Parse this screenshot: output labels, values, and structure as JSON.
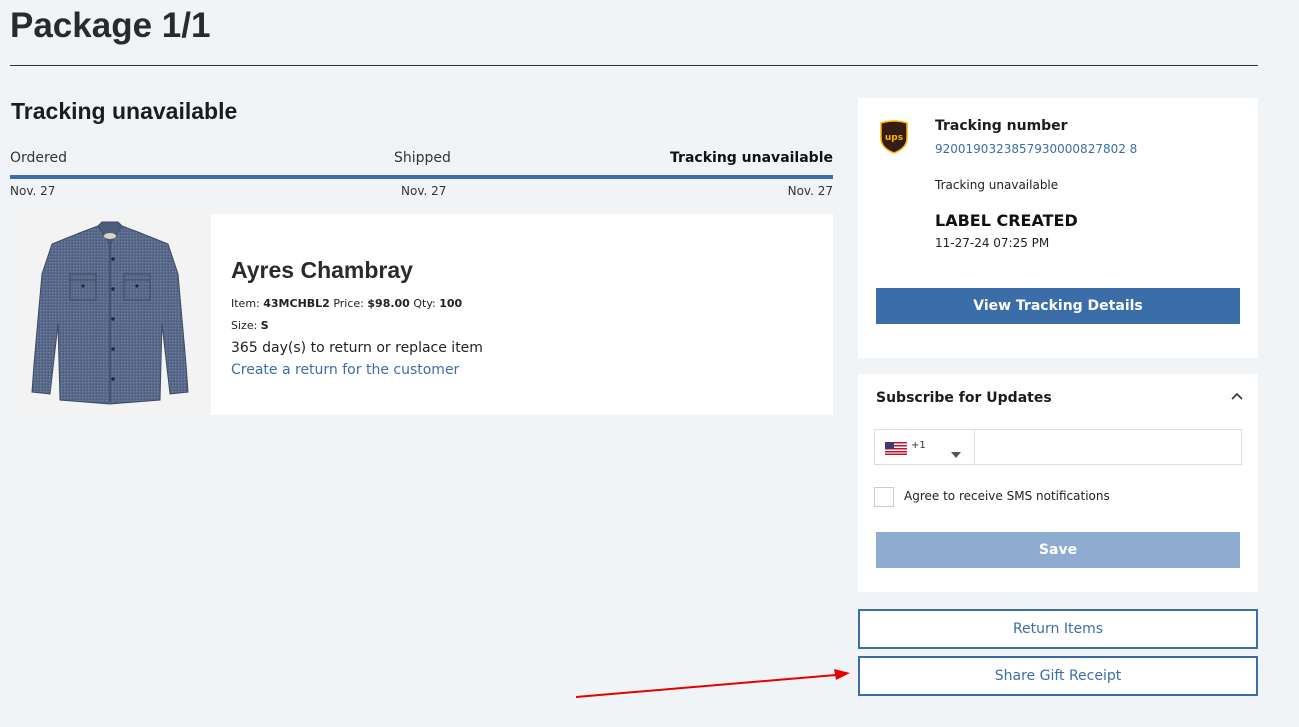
{
  "package": {
    "title": "Package 1/1"
  },
  "tracking_progress": {
    "heading": "Tracking unavailable",
    "progress_fraction": 1.0,
    "steps": [
      {
        "label": "Ordered",
        "date": "Nov. 27"
      },
      {
        "label": "Shipped",
        "date": "Nov. 27"
      },
      {
        "label": "Tracking unavailable",
        "date": "Nov. 27"
      }
    ]
  },
  "item": {
    "name": "Ayres Chambray",
    "item_label": "Item:",
    "item_code": "43MCHBL2",
    "price_label": "Price:",
    "price": "$98.00",
    "qty_label": "Qty:",
    "qty": "100",
    "size_label": "Size:",
    "size": "S",
    "return_window": "365 day(s) to return or replace item",
    "create_return_link": "Create a return for the customer",
    "image_icon": "chambray-shirt-image"
  },
  "tracking_card": {
    "carrier_icon": "ups-logo-icon",
    "tracking_number_label": "Tracking number",
    "tracking_number": "9200190323857930000827802 8",
    "status": "Tracking unavailable",
    "event": "LABEL CREATED",
    "event_time": "11-27-24 07:25 PM",
    "view_button": "View Tracking Details"
  },
  "subscribe": {
    "title": "Subscribe for Updates",
    "country_code": "+1",
    "phone_value": "",
    "sms_label": "Agree to receive SMS notifications",
    "sms_checked": false,
    "save_button": "Save"
  },
  "actions": {
    "return_items": "Return Items",
    "share_gift_receipt": "Share Gift Receipt"
  },
  "colors": {
    "accent": "#3b6ea8",
    "disabled_button": "#8dacd0",
    "annotation_arrow": "#e60000",
    "background": "#f1f4f7"
  }
}
